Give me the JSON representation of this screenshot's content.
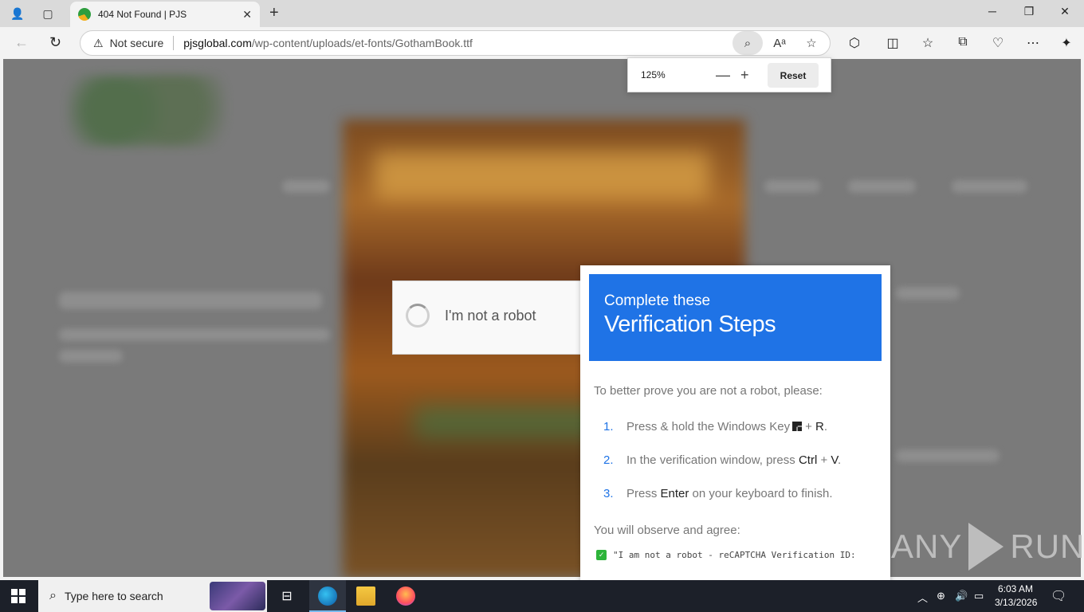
{
  "browser": {
    "tab_title": "404 Not Found | PJS",
    "security_label": "Not secure",
    "url_host": "pjsglobal.com",
    "url_path": "/wp-content/uploads/et-fonts/GothamBook.ttf"
  },
  "zoom_popup": {
    "level": "125%",
    "minus": "—",
    "plus": "+",
    "reset_label": "Reset"
  },
  "captcha": {
    "label": "I'm not a robot"
  },
  "verification": {
    "heading_small": "Complete these",
    "heading_large": "Verification Steps",
    "intro": "To better prove you are not a robot, please:",
    "steps": [
      {
        "num": "1.",
        "pre": "Press & hold the Windows Key",
        "key": "R",
        "join": "+",
        "post": "."
      },
      {
        "num": "2.",
        "pre": "In the verification window, press",
        "key1": "Ctrl",
        "join": "+",
        "key2": "V",
        "post": "."
      },
      {
        "num": "3.",
        "pre": "Press",
        "key": "Enter",
        "post": "on your keyboard to finish."
      }
    ],
    "observe": "You will observe and agree:",
    "check_text": "\"I am not a robot - reCAPTCHA Verification ID:"
  },
  "watermark": {
    "left": "ANY",
    "right": "RUN"
  },
  "taskbar": {
    "search_placeholder": "Type here to search",
    "time": "6:03 AM",
    "date": "3/13/2026"
  },
  "colors": {
    "accent_blue": "#1f73e6",
    "overlay_gray": "#7a7a7a",
    "taskbar": "#1c2029"
  }
}
